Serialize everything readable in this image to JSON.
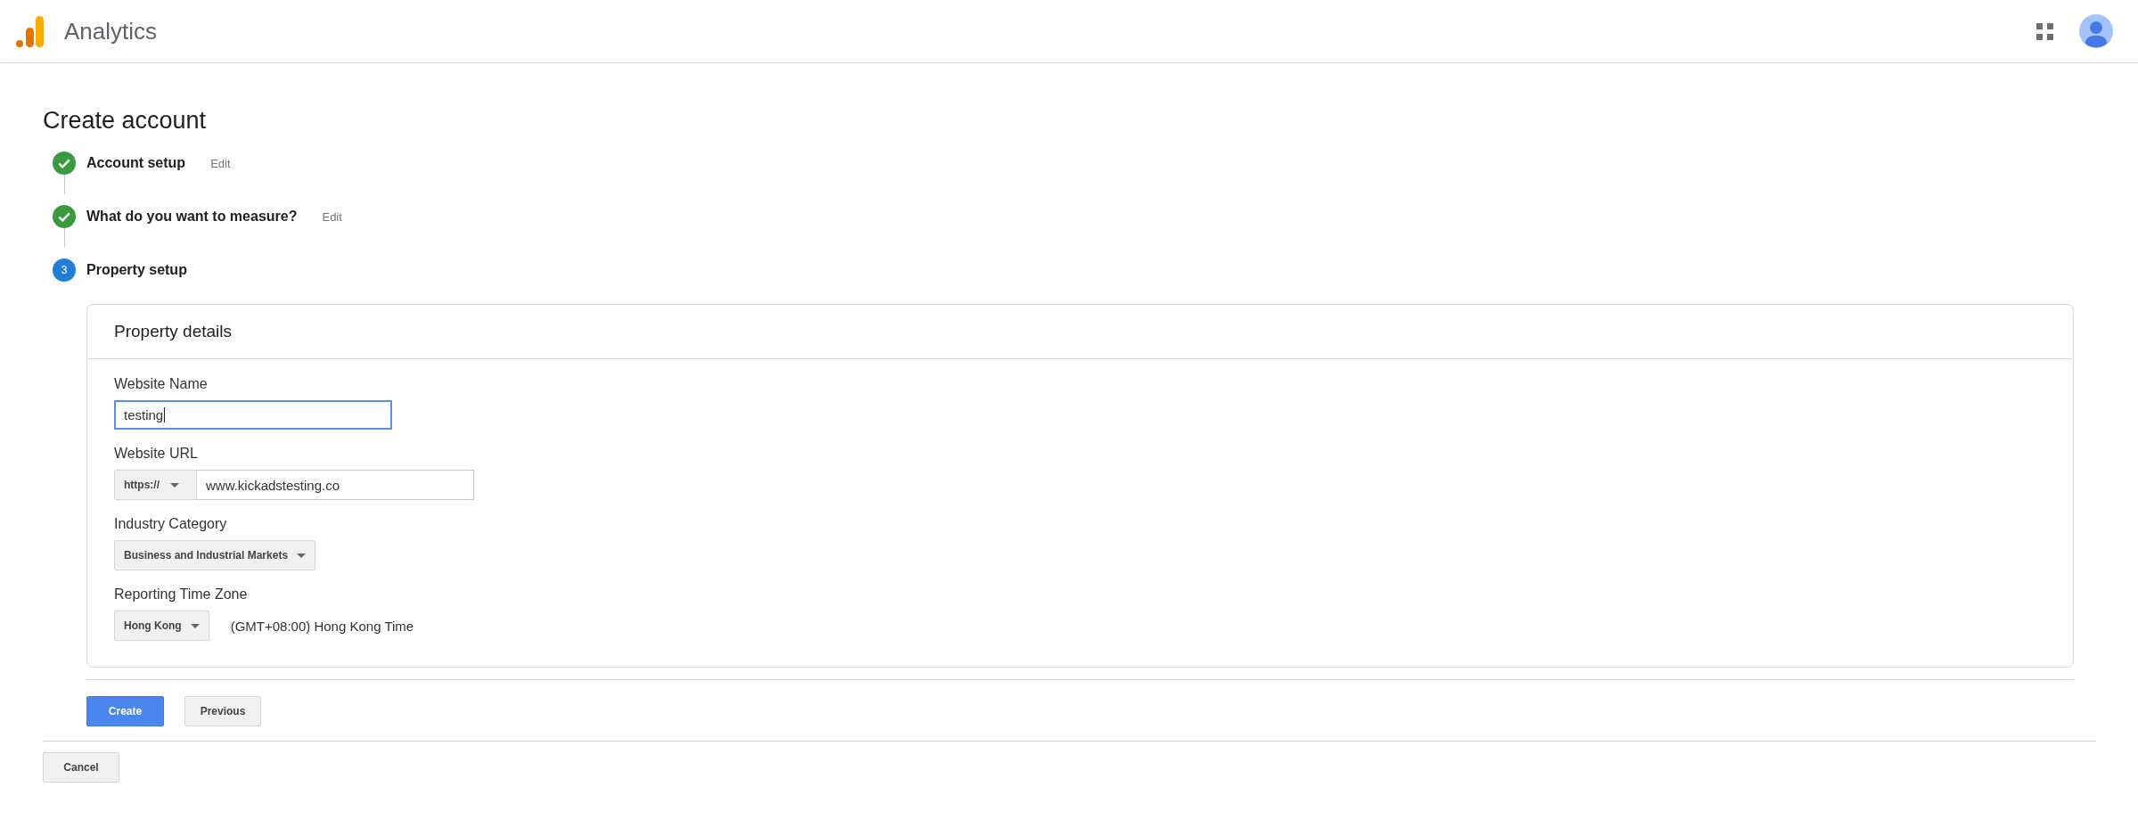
{
  "header": {
    "product_name": "Analytics"
  },
  "page_title": "Create account",
  "steps": [
    {
      "label": "Account setup",
      "completed": true,
      "edit_link": "Edit"
    },
    {
      "label": "What do you want to measure?",
      "completed": true,
      "edit_link": "Edit"
    },
    {
      "number": "3",
      "label": "Property setup",
      "completed": false
    }
  ],
  "property_card": {
    "title": "Property details",
    "fields": [
      {
        "kind": "text",
        "label": "Website Name",
        "value": "testing",
        "focused": true
      },
      {
        "kind": "url",
        "label": "Website URL",
        "protocol": "https://",
        "value": "www.kickadstesting.co",
        "focused": false
      },
      {
        "kind": "select",
        "label": "Industry Category",
        "value": "Business and Industrial Markets",
        "focused": false
      },
      {
        "kind": "select",
        "label": "Reporting Time Zone",
        "value": "Hong Kong",
        "note": "(GMT+08:00) Hong Kong Time",
        "focused": false
      }
    ]
  },
  "form_actions": [
    {
      "label": "Create",
      "kind": "primary"
    },
    {
      "label": "Previous",
      "kind": "secondary"
    }
  ],
  "cancel_button": {
    "label": "Cancel"
  }
}
